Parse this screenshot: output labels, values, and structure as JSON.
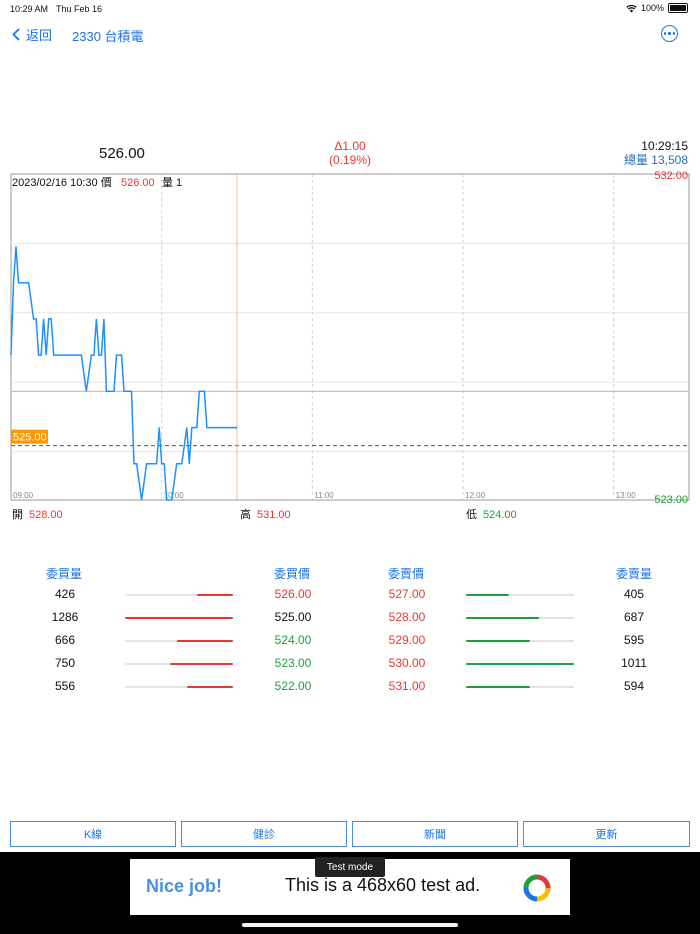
{
  "status_bar": {
    "time": "10:29 AM",
    "date": "Thu Feb 16",
    "battery": "100%"
  },
  "nav": {
    "back_label": "返回",
    "title": "2330 台積電"
  },
  "quote": {
    "price": "526.00",
    "change": "Δ1.00",
    "change_pct": "(0.19%)",
    "time": "10:29:15",
    "volume_label": "總量",
    "volume": "13,508"
  },
  "chart_data": {
    "type": "line",
    "info": {
      "datetime": "2023/02/16 10:30",
      "price_label": "價",
      "price": "526.00",
      "volume_label": "量",
      "volume": "1"
    },
    "ylim": [
      523,
      532
    ],
    "y_max_label": "532.00",
    "y_min_label": "523.00",
    "reference_label": "525.00",
    "reference_value": 524.5,
    "upper_line_value": 526,
    "x_ticks": [
      "09:00",
      "10:00",
      "11:00",
      "12:00",
      "13:00"
    ],
    "cursor_time": "10:30",
    "x": [
      "09:00",
      "09:01",
      "09:02",
      "09:03",
      "09:05",
      "09:07",
      "09:09",
      "09:10",
      "09:11",
      "09:12",
      "09:13",
      "09:14",
      "09:15",
      "09:16",
      "09:17",
      "09:18",
      "09:20",
      "09:22",
      "09:24",
      "09:26",
      "09:28",
      "09:30",
      "09:32",
      "09:33",
      "09:34",
      "09:35",
      "09:36",
      "09:37",
      "09:38",
      "09:40",
      "09:41",
      "09:42",
      "09:43",
      "09:44",
      "09:45",
      "09:46",
      "09:47",
      "09:48",
      "09:49",
      "09:50",
      "09:52",
      "09:54",
      "09:56",
      "09:57",
      "09:58",
      "09:59",
      "10:00",
      "10:01",
      "10:02",
      "10:04",
      "10:06",
      "10:08",
      "10:10",
      "10:11",
      "10:12",
      "10:13",
      "10:14",
      "10:15",
      "10:16",
      "10:17",
      "10:18",
      "10:19",
      "10:20",
      "10:21",
      "10:22",
      "10:23",
      "10:24",
      "10:25",
      "10:26",
      "10:27",
      "10:28",
      "10:29",
      "10:30"
    ],
    "values": [
      527,
      529,
      530,
      529,
      529,
      529,
      528,
      528,
      527,
      527,
      528,
      527,
      528,
      528,
      527,
      527,
      527,
      527,
      527,
      527,
      527,
      526,
      527,
      527,
      528,
      527,
      527,
      528,
      526,
      526,
      526,
      527,
      527,
      527,
      526,
      526,
      526,
      526,
      524,
      524,
      523,
      524,
      524,
      524,
      524,
      525,
      524,
      524,
      523,
      523,
      524,
      524,
      525,
      524,
      525,
      525,
      525,
      526,
      526,
      526,
      525,
      525,
      525,
      525,
      525,
      525,
      525,
      525,
      525,
      525,
      525,
      525,
      525
    ]
  },
  "ohl": {
    "open_label": "開",
    "open": "528.00",
    "high_label": "高",
    "high": "531.00",
    "low_label": "低",
    "low": "524.00"
  },
  "orderbook": {
    "headers": {
      "bid_vol": "委買量",
      "bid_price": "委買價",
      "ask_price": "委賣價",
      "ask_vol": "委賣量"
    },
    "rows": [
      {
        "bid_vol": "426",
        "bid_fill": 0.33,
        "bid_price": "526.00",
        "ask_price": "527.00",
        "ask_fill": 0.4,
        "ask_vol": "405"
      },
      {
        "bid_vol": "1286",
        "bid_fill": 1.0,
        "bid_price": "525.00",
        "ask_price": "528.00",
        "ask_fill": 0.68,
        "ask_vol": "687"
      },
      {
        "bid_vol": "666",
        "bid_fill": 0.52,
        "bid_price": "524.00",
        "ask_price": "529.00",
        "ask_fill": 0.59,
        "ask_vol": "595"
      },
      {
        "bid_vol": "750",
        "bid_fill": 0.58,
        "bid_price": "523.00",
        "ask_price": "530.00",
        "ask_fill": 1.0,
        "ask_vol": "1011"
      },
      {
        "bid_vol": "556",
        "bid_fill": 0.43,
        "bid_price": "522.00",
        "ask_price": "531.00",
        "ask_fill": 0.59,
        "ask_vol": "594"
      }
    ]
  },
  "buttons": [
    "K線",
    "健診",
    "新聞",
    "更新"
  ],
  "ad": {
    "test_mode": "Test mode",
    "nice": "Nice job!",
    "text": "This is a 468x60 test ad."
  },
  "colors": {
    "accent": "#1a73e8",
    "up": "#e53935",
    "down": "#1e9e3c",
    "line": "#1e90ff",
    "reference": "#ff9800"
  }
}
